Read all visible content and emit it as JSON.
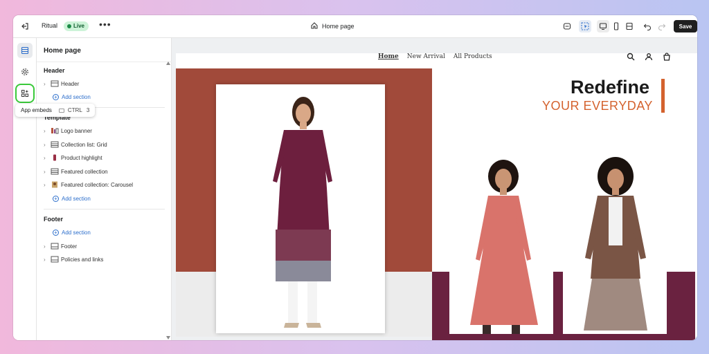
{
  "topbar": {
    "store_name": "Ritual",
    "live_badge": "Live",
    "more_label": "•••",
    "page_label": "Home page",
    "save_label": "Save"
  },
  "sidebar": {
    "title": "Home page",
    "header_group": "Header",
    "header_items": [
      "Header"
    ],
    "add_section": "Add section",
    "template_group": "Template",
    "template_items": [
      "Logo banner",
      "Collection list: Grid",
      "Product highlight",
      "Featured collection",
      "Featured collection: Carousel"
    ],
    "footer_group": "Footer",
    "footer_items": [
      "Footer",
      "Policies and links"
    ]
  },
  "tooltip": {
    "label": "App embeds",
    "key": "CTRL",
    "num": "3"
  },
  "store": {
    "nav": [
      "Home",
      "New Arrival",
      "All Products"
    ],
    "hero_title": "Redefine",
    "hero_sub": "YOUR EVERYDAY"
  },
  "colors": {
    "rust": "#a14a3a",
    "plum": "#6a2240",
    "accent": "#d4622e",
    "live_bg": "#cdf3d8",
    "link": "#2c6ecb",
    "highlight": "#3ac93a"
  }
}
